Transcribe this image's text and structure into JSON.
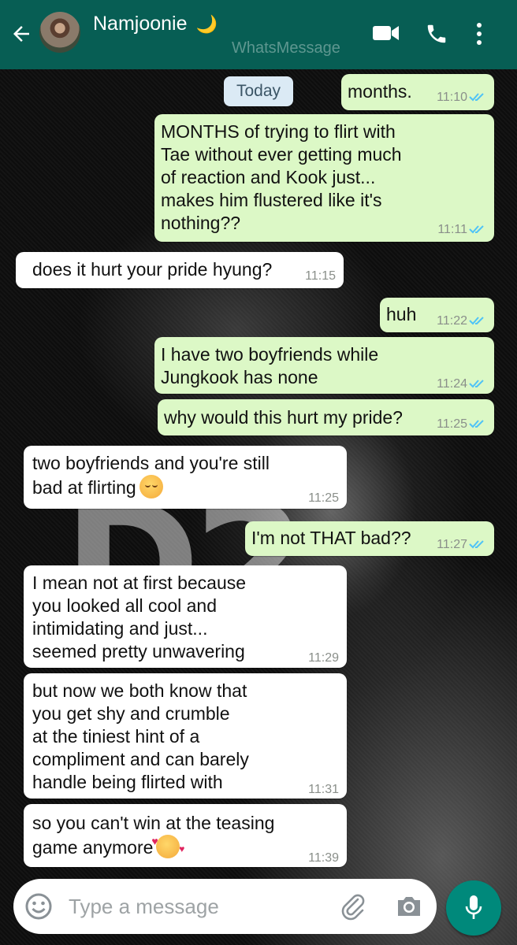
{
  "header": {
    "contact_name": "Namjoonie",
    "name_emoji": "🌙",
    "watermark": "WhatsMessage",
    "icons": [
      "back-arrow-icon",
      "video-call-icon",
      "voice-call-icon",
      "more-options-icon"
    ]
  },
  "date_divider": "Today",
  "messages": [
    {
      "dir": "out",
      "lines": [
        "months."
      ],
      "time": "11:10",
      "read": true
    },
    {
      "dir": "out",
      "lines": [
        "MONTHS of trying to flirt with",
        "Tae without ever getting much",
        "of reaction and Kook just...",
        "makes him flustered like it's",
        "nothing??"
      ],
      "time": "11:11",
      "read": true
    },
    {
      "dir": "in",
      "lines": [
        "does it hurt your pride hyung?"
      ],
      "time": "11:15"
    },
    {
      "dir": "out",
      "lines": [
        "huh"
      ],
      "time": "11:22",
      "read": true
    },
    {
      "dir": "out",
      "lines": [
        "I have two boyfriends while",
        "Jungkook has none"
      ],
      "time": "11:24",
      "read": true
    },
    {
      "dir": "out",
      "lines": [
        "why would this hurt my pride?"
      ],
      "time": "11:25",
      "read": true
    },
    {
      "dir": "in",
      "lines": [
        "two boyfriends and you're still",
        "bad at flirting"
      ],
      "emoji": "relieved-face",
      "time": "11:25"
    },
    {
      "dir": "out",
      "lines": [
        "I'm not THAT bad??"
      ],
      "time": "11:27",
      "read": true
    },
    {
      "dir": "in",
      "lines": [
        "I mean not at first because",
        "you looked all cool and",
        "intimidating and just...",
        "seemed pretty unwavering"
      ],
      "time": "11:29"
    },
    {
      "dir": "in",
      "lines": [
        "but now we both know that",
        "you get shy and crumble",
        "at the tiniest hint of a",
        "compliment and can barely",
        "handle being flirted with"
      ],
      "time": "11:31"
    },
    {
      "dir": "in",
      "lines": [
        "so you can't win at the teasing",
        "game anymore"
      ],
      "emoji": "smiling-face-with-hearts",
      "time": "11:39"
    }
  ],
  "input": {
    "placeholder": "Type a message"
  },
  "colors": {
    "header": "#075e54",
    "outgoing_bubble": "#dcf8c6",
    "incoming_bubble": "#ffffff",
    "read_tick": "#4fc3f7",
    "mic_button": "#00897b"
  }
}
